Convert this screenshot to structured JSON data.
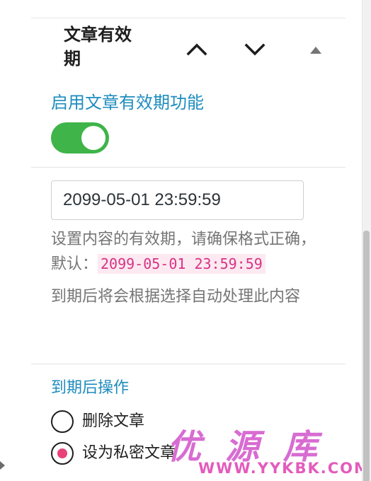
{
  "panel": {
    "title": "文章有效期",
    "controls": {
      "move_up": "chevron-up-icon",
      "move_down": "chevron-down-icon",
      "collapse": "triangle-up-icon"
    }
  },
  "enable": {
    "label": "启用文章有效期功能",
    "toggle_on": true,
    "toggle_color": "#3fb449"
  },
  "expiry": {
    "value": "2099-05-01 23:59:59",
    "help_text_1": "设置内容的有效期，请确保格式正确，默认：",
    "help_code": "2099-05-01 23:59:59",
    "help_text_2": "到期后将会根据选择自动处理此内容"
  },
  "action": {
    "label": "到期后操作",
    "options": [
      {
        "label": "删除文章",
        "checked": false
      },
      {
        "label": "设为私密文章",
        "checked": true
      }
    ]
  },
  "watermark": {
    "chars": [
      "优",
      "源",
      "库"
    ],
    "url": "WWW.YYKBK.COM"
  },
  "colors": {
    "accent_blue": "#1e8cbe",
    "radio_checked": "#e9407a",
    "code_text": "#d63384",
    "watermark": "#d86cd2"
  }
}
